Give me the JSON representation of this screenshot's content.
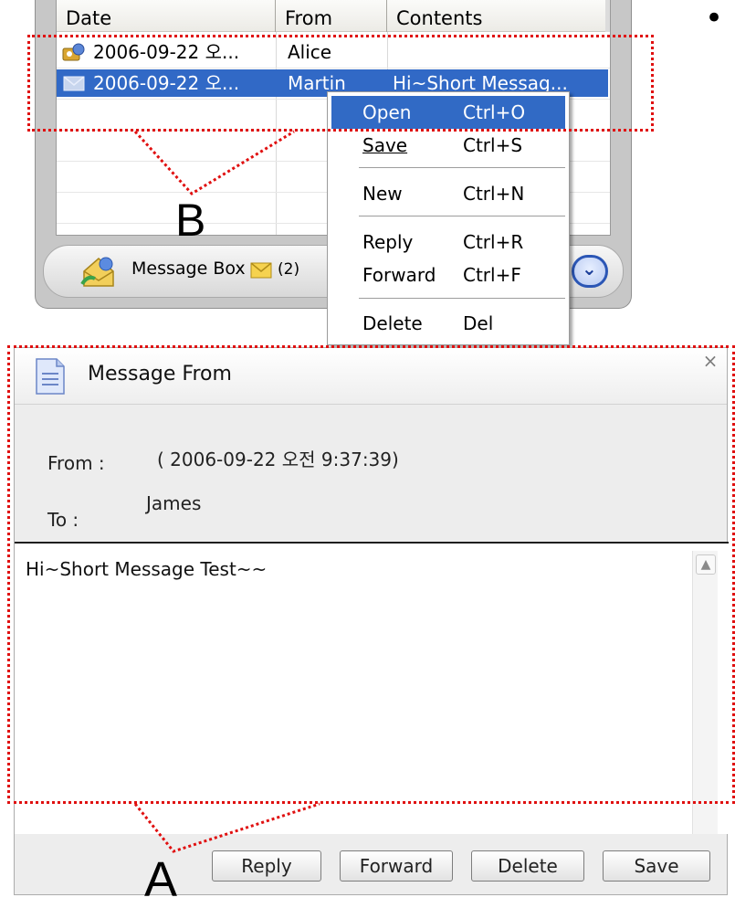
{
  "message_list": {
    "columns": [
      "Date",
      "From",
      "Contents"
    ],
    "rows": [
      {
        "date": "2006-09-22 오...",
        "from": "Alice",
        "contents": "",
        "icon": "meeting-request-icon"
      },
      {
        "date": "2006-09-22 오...",
        "from": "Martin",
        "contents": "Hi~Short Messag...",
        "icon": "envelope-icon",
        "selected": true
      }
    ],
    "bottom_bar": {
      "label": "Message Box",
      "count": "(2)"
    }
  },
  "context_menu": {
    "items": [
      {
        "label": "Open",
        "shortcut": "Ctrl+O",
        "highlighted": true
      },
      {
        "label": "Save",
        "shortcut": "Ctrl+S"
      },
      {
        "label": "New",
        "shortcut": "Ctrl+N"
      },
      {
        "label": "Reply",
        "shortcut": "Ctrl+R"
      },
      {
        "label": "Forward",
        "shortcut": "Ctrl+F"
      },
      {
        "label": "Delete",
        "shortcut": "Del"
      }
    ]
  },
  "message_window": {
    "title": "Message From",
    "from_label": "From :",
    "from_value": "( 2006-09-22 오전 9:37:39)",
    "to_label": "To :",
    "to_value": "James",
    "body": "Hi~Short Message Test~~",
    "buttons": {
      "reply": "Reply",
      "forward": "Forward",
      "delete": "Delete",
      "save": "Save"
    },
    "close_symbol": "×"
  },
  "annotations": {
    "a": "A",
    "b": "B",
    "bullet": "•"
  },
  "colors": {
    "selection": "#3169c6",
    "annotation": "#e01010"
  }
}
